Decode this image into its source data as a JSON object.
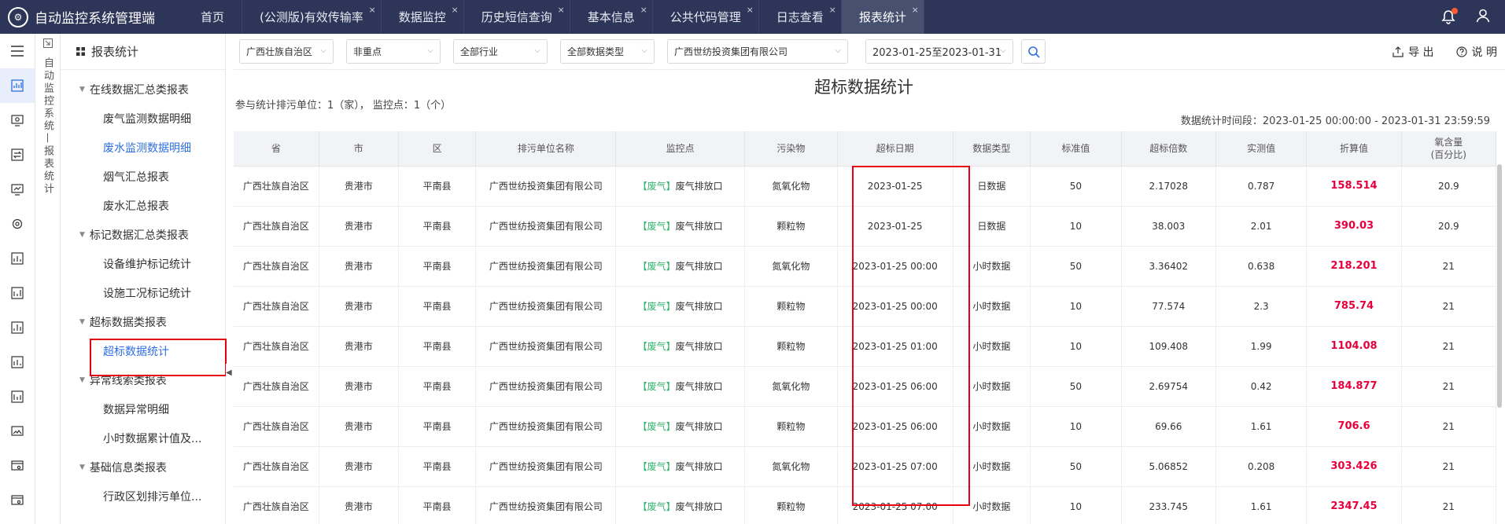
{
  "app": {
    "title": "自动监控系统管理端",
    "emblem": "⚙"
  },
  "tabs": [
    {
      "label": "首页",
      "closable": false
    },
    {
      "label": "(公测版)有效传输率",
      "closable": true
    },
    {
      "label": "数据监控",
      "closable": true
    },
    {
      "label": "历史短信查询",
      "closable": true
    },
    {
      "label": "基本信息",
      "closable": true
    },
    {
      "label": "公共代码管理",
      "closable": true
    },
    {
      "label": "日志查看",
      "closable": true
    },
    {
      "label": "报表统计",
      "closable": true,
      "active": true
    }
  ],
  "vertical_label": "自动监控系统—报表统计",
  "sidebar": {
    "title": "报表统计",
    "groups": [
      {
        "label": "在线数据汇总类报表",
        "items": [
          "废气监测数据明细",
          "废水监测数据明细",
          "烟气汇总报表",
          "废水汇总报表"
        ]
      },
      {
        "label": "标记数据汇总类报表",
        "items": [
          "设备维护标记统计",
          "设施工况标记统计"
        ]
      },
      {
        "label": "超标数据类报表",
        "items": [
          "超标数据统计"
        ]
      },
      {
        "label": "异常线索类报表",
        "items": [
          "数据异常明细",
          "小时数据累计值及..."
        ]
      },
      {
        "label": "基础信息类报表",
        "items": [
          "行政区划排污单位..."
        ]
      }
    ]
  },
  "filters": {
    "province": "广西壮族自治区",
    "key_point": "非重点",
    "industry": "全部行业",
    "data_type": "全部数据类型",
    "company": "广西世纺投资集团有限公司",
    "date_range": "2023-01-25至2023-01-31",
    "export": "导 出",
    "help": "说 明"
  },
  "report": {
    "title": "超标数据统计",
    "summary": "参与统计排污单位：1（家），  监控点：1（个）",
    "period": "数据统计时间段：2023-01-25 00:00:00 - 2023-01-31 23:59:59"
  },
  "table": {
    "headers": [
      "省",
      "市",
      "区",
      "排污单位名称",
      "监控点",
      "污染物",
      "超标日期",
      "数据类型",
      "标准值",
      "超标倍数",
      "实测值",
      "折算值",
      "氧含量\n(百分比)"
    ],
    "rows": [
      [
        "广西壮族自治区",
        "贵港市",
        "平南县",
        "广西世纺投资集团有限公司",
        "【废气】",
        "废气排放口",
        "氮氧化物",
        "2023-01-25",
        "日数据",
        "50",
        "2.17028",
        "0.787",
        "158.514",
        "20.9"
      ],
      [
        "广西壮族自治区",
        "贵港市",
        "平南县",
        "广西世纺投资集团有限公司",
        "【废气】",
        "废气排放口",
        "颗粒物",
        "2023-01-25",
        "日数据",
        "10",
        "38.003",
        "2.01",
        "390.03",
        "20.9"
      ],
      [
        "广西壮族自治区",
        "贵港市",
        "平南县",
        "广西世纺投资集团有限公司",
        "【废气】",
        "废气排放口",
        "氮氧化物",
        "2023-01-25 00:00",
        "小时数据",
        "50",
        "3.36402",
        "0.638",
        "218.201",
        "21"
      ],
      [
        "广西壮族自治区",
        "贵港市",
        "平南县",
        "广西世纺投资集团有限公司",
        "【废气】",
        "废气排放口",
        "颗粒物",
        "2023-01-25 00:00",
        "小时数据",
        "10",
        "77.574",
        "2.3",
        "785.74",
        "21"
      ],
      [
        "广西壮族自治区",
        "贵港市",
        "平南县",
        "广西世纺投资集团有限公司",
        "【废气】",
        "废气排放口",
        "颗粒物",
        "2023-01-25 01:00",
        "小时数据",
        "10",
        "109.408",
        "1.99",
        "1104.08",
        "21"
      ],
      [
        "广西壮族自治区",
        "贵港市",
        "平南县",
        "广西世纺投资集团有限公司",
        "【废气】",
        "废气排放口",
        "氮氧化物",
        "2023-01-25 06:00",
        "小时数据",
        "50",
        "2.69754",
        "0.42",
        "184.877",
        "21"
      ],
      [
        "广西壮族自治区",
        "贵港市",
        "平南县",
        "广西世纺投资集团有限公司",
        "【废气】",
        "废气排放口",
        "颗粒物",
        "2023-01-25 06:00",
        "小时数据",
        "10",
        "69.66",
        "1.61",
        "706.6",
        "21"
      ],
      [
        "广西壮族自治区",
        "贵港市",
        "平南县",
        "广西世纺投资集团有限公司",
        "【废气】",
        "废气排放口",
        "氮氧化物",
        "2023-01-25 07:00",
        "小时数据",
        "50",
        "5.06852",
        "0.208",
        "303.426",
        "21"
      ],
      [
        "广西壮族自治区",
        "贵港市",
        "平南县",
        "广西世纺投资集团有限公司",
        "【废气】",
        "废气排放口",
        "颗粒物",
        "2023-01-25 07:00",
        "小时数据",
        "10",
        "233.745",
        "1.61",
        "2347.45",
        "21"
      ]
    ]
  },
  "colors": {
    "topbar": "#2d3558",
    "accent": "#2f6fe0",
    "highlight_box": "#e60012",
    "exceed_value": "#e8003c",
    "tag": "#31b36b"
  }
}
